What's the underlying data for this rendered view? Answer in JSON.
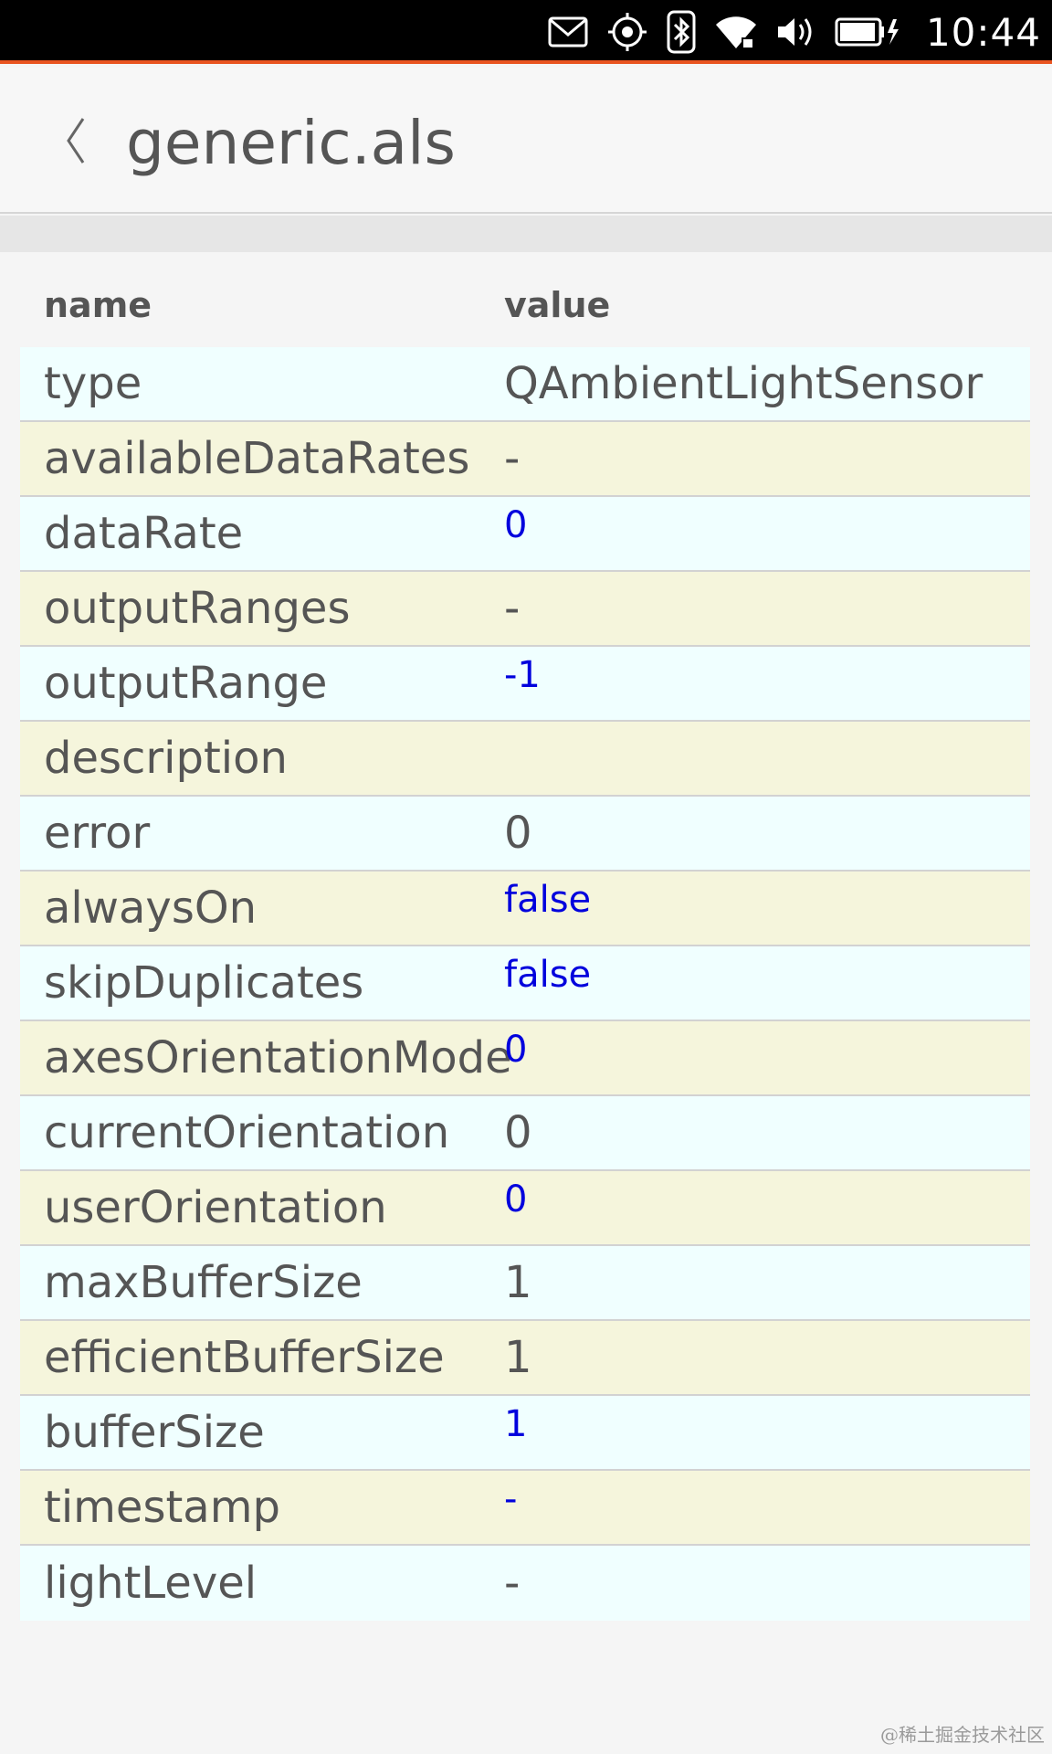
{
  "status_bar": {
    "time": "10:44",
    "icons": [
      "mail-icon",
      "location-icon",
      "bluetooth-icon",
      "wifi-icon",
      "volume-icon",
      "battery-charging-icon"
    ]
  },
  "header": {
    "back_glyph": "〈",
    "title": "generic.als"
  },
  "table": {
    "columns": [
      "name",
      "value"
    ],
    "rows": [
      {
        "name": "type",
        "value": "QAmbientLightSensor",
        "editable": false
      },
      {
        "name": "availableDataRates",
        "value": "-",
        "editable": false
      },
      {
        "name": "dataRate",
        "value": "0",
        "editable": true
      },
      {
        "name": "outputRanges",
        "value": "-",
        "editable": false
      },
      {
        "name": "outputRange",
        "value": "-1",
        "editable": true
      },
      {
        "name": "description",
        "value": "",
        "editable": false
      },
      {
        "name": "error",
        "value": "0",
        "editable": false
      },
      {
        "name": "alwaysOn",
        "value": "false",
        "editable": true
      },
      {
        "name": "skipDuplicates",
        "value": "false",
        "editable": true
      },
      {
        "name": "axesOrientationMode",
        "value": "0",
        "editable": true
      },
      {
        "name": "currentOrientation",
        "value": "0",
        "editable": false
      },
      {
        "name": "userOrientation",
        "value": "0",
        "editable": true
      },
      {
        "name": "maxBufferSize",
        "value": "1",
        "editable": false
      },
      {
        "name": "efficientBufferSize",
        "value": "1",
        "editable": false
      },
      {
        "name": "bufferSize",
        "value": "1",
        "editable": true
      },
      {
        "name": "timestamp",
        "value": "-",
        "editable": true
      },
      {
        "name": "lightLevel",
        "value": "-",
        "editable": false
      }
    ]
  },
  "watermark": "@稀土掘金技术社区",
  "colors": {
    "accent": "#e95420",
    "row_even": "#f0ffff",
    "row_odd": "#f5f5dc",
    "editable_text": "#0000dd"
  }
}
